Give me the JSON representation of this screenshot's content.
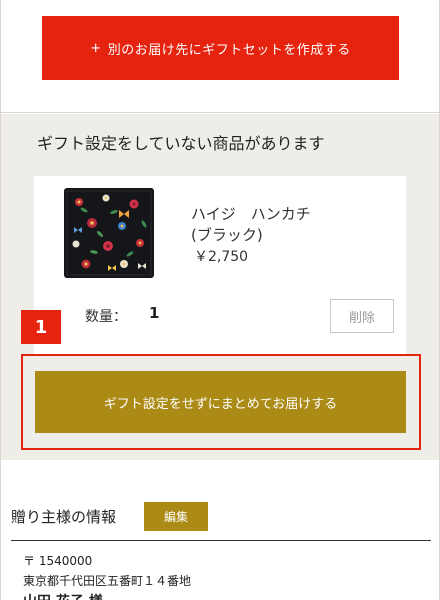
{
  "top": {
    "add_gift_label": "別のお届け先にギフトセットを作成する",
    "add_icon": "+"
  },
  "notice": {
    "heading": "ギフト設定をしていない商品があります"
  },
  "product": {
    "name_line1": "ハイジ　ハンカチ",
    "name_line2": "(ブラック)",
    "price": "￥2,750",
    "qty_label": "数量：",
    "qty_value": "1",
    "delete_label": "削除",
    "thumbnail_icon": "floral-handkerchief-image"
  },
  "step": {
    "number": "1"
  },
  "combine": {
    "label": "ギフト設定をせずにまとめてお届けする"
  },
  "sender": {
    "title": "贈り主様の情報",
    "edit_label": "編集",
    "postal": "〒 1540000",
    "address": "東京都千代田区五番町１４番地",
    "name": "山田 花子 様"
  },
  "colors": {
    "accent_red": "#e6230f",
    "gold": "#ac8a16",
    "gray_bg": "#efede8"
  }
}
